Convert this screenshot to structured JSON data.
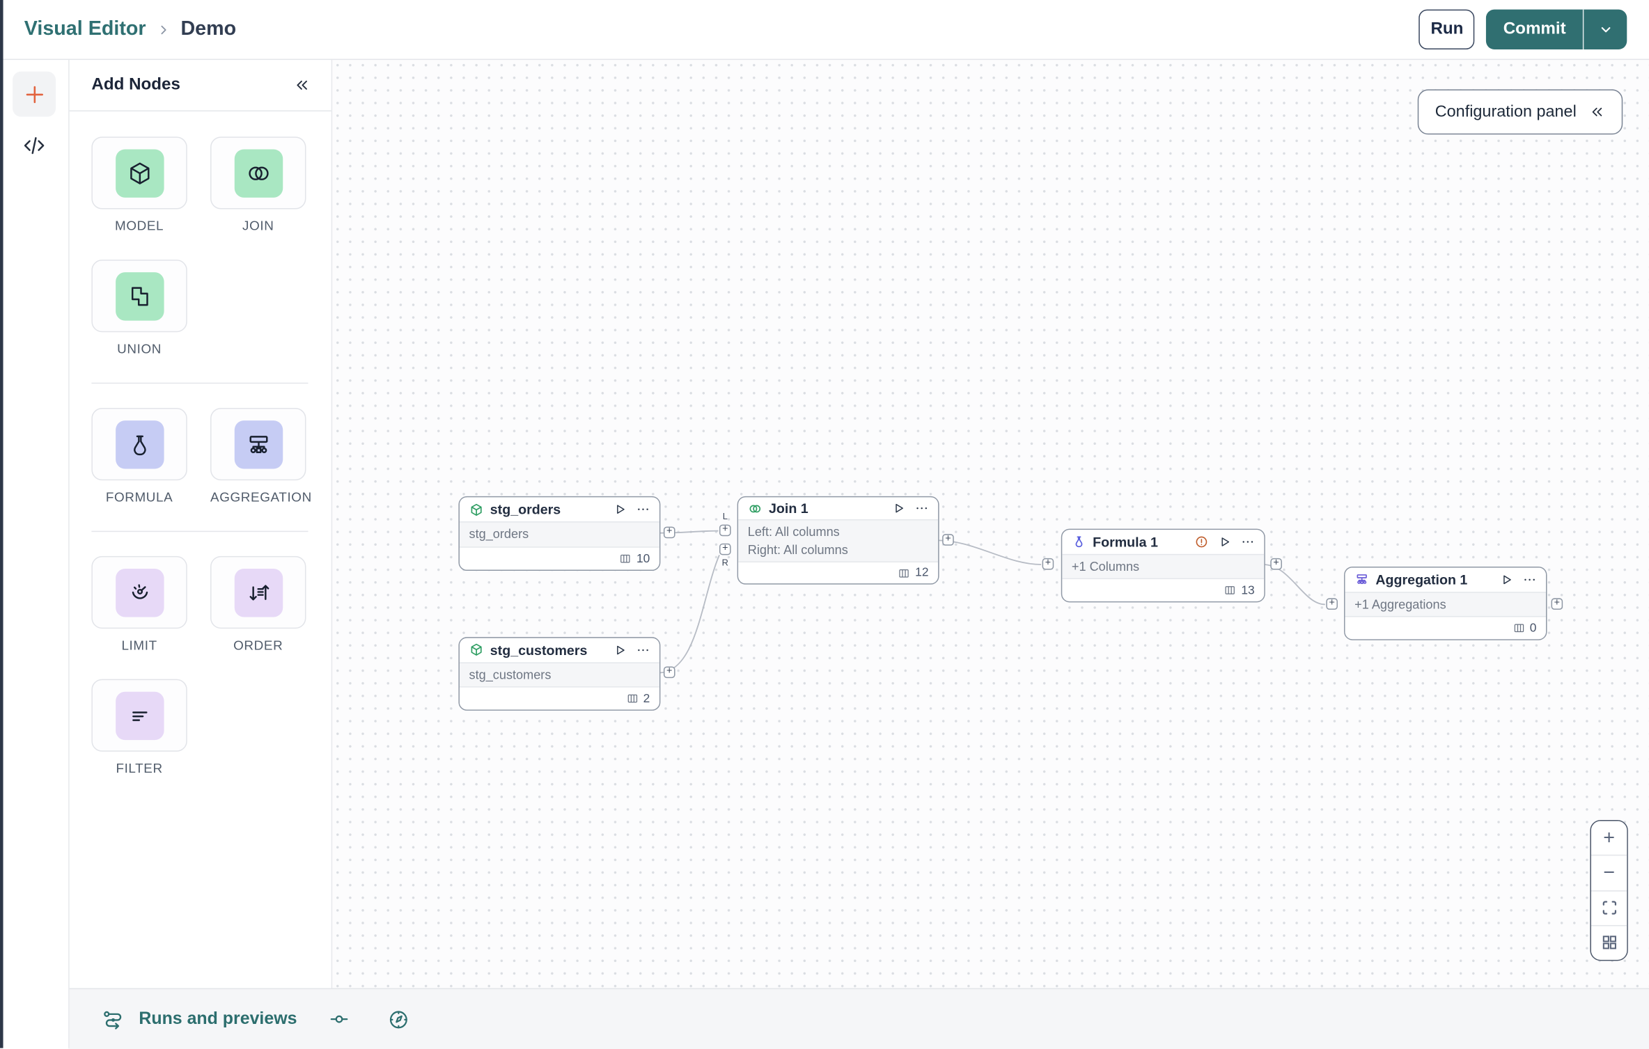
{
  "colors": {
    "brand_teal": "#2f7072",
    "accent_orange": "#e2633e",
    "node_green": "#2f9e63",
    "node_indigo": "#5a5fde",
    "node_purple": "#6a5cd8",
    "warning_orange": "#bf5d2c",
    "tile_green": "#a9e7c2",
    "tile_periwinkle": "#c6ccf4",
    "tile_lilac": "#e7d9f7"
  },
  "header": {
    "breadcrumb": [
      "Visual Editor",
      "Demo"
    ],
    "run_label": "Run",
    "commit_label": "Commit"
  },
  "add_nodes": {
    "title": "Add Nodes",
    "tiles": [
      {
        "label": "MODEL",
        "icon": "cube-icon"
      },
      {
        "label": "JOIN",
        "icon": "join-circles-icon"
      },
      {
        "label": "UNION",
        "icon": "union-squares-icon"
      },
      {
        "label": "FORMULA",
        "icon": "flask-icon"
      },
      {
        "label": "AGGREGATION",
        "icon": "aggregation-tree-icon"
      },
      {
        "label": "LIMIT",
        "icon": "gauge-icon"
      },
      {
        "label": "ORDER",
        "icon": "sort-arrows-icon"
      },
      {
        "label": "FILTER",
        "icon": "filter-lines-icon"
      }
    ]
  },
  "canvas": {
    "config_panel_label": "Configuration panel",
    "plus": "+",
    "join_input_labels": [
      "L",
      "R"
    ],
    "zoom_controls": {
      "zoom_in": "+",
      "zoom_out": "−"
    },
    "nodes": [
      {
        "title": "stg_orders",
        "body": [
          "stg_orders"
        ],
        "count": "10"
      },
      {
        "title": "Join 1",
        "body": [
          "Left: All columns",
          "Right: All columns"
        ],
        "count": "12"
      },
      {
        "title": "Formula 1",
        "body": [
          "+1 Columns"
        ],
        "count": "13"
      },
      {
        "title": "Aggregation 1",
        "body": [
          "+1 Aggregations"
        ],
        "count": "0"
      },
      {
        "title": "stg_customers",
        "body": [
          "stg_customers"
        ],
        "count": "2"
      }
    ]
  },
  "bottom_bar": {
    "label": "Runs and previews"
  }
}
